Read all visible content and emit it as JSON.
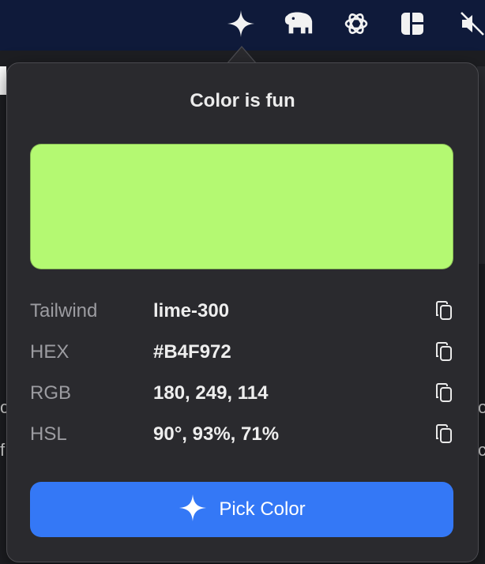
{
  "menubar": {
    "icons": [
      "sparkle-icon",
      "elephant-icon",
      "openai-icon",
      "layout-grid-icon",
      "mute-icon"
    ]
  },
  "popover": {
    "title": "Color is fun",
    "swatch_color": "#B4F972",
    "rows": [
      {
        "label": "Tailwind",
        "value": "lime-300"
      },
      {
        "label": "HEX",
        "value": "#B4F972"
      },
      {
        "label": "RGB",
        "value": "180, 249, 114"
      },
      {
        "label": "HSL",
        "value": "90°, 93%, 71%"
      }
    ],
    "pick_button": {
      "label": "Pick Color",
      "color": "#3478F6"
    }
  }
}
